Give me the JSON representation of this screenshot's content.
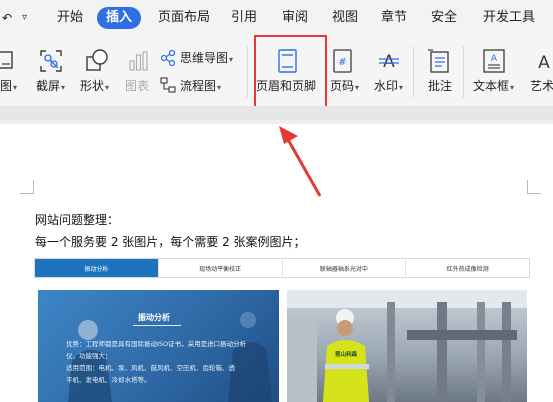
{
  "tabs": [
    "开始",
    "插入",
    "页面布局",
    "引用",
    "审阅",
    "视图",
    "章节",
    "安全",
    "开发工具"
  ],
  "active_tab": "插入",
  "toolbar": {
    "image_label": "图",
    "screenshot_label": "截屏",
    "shape_label": "形状",
    "icon_label": "图表",
    "mindmap_label": "思维导图",
    "flowchart_label": "流程图",
    "header_footer_label": "页眉和页脚",
    "page_number_label": "页码",
    "watermark_label": "水印",
    "comment_label": "批注",
    "textbox_label": "文本框",
    "art_label": "艺术"
  },
  "colors": {
    "accent": "#2f6fe4",
    "highlight": "#e53935",
    "nav_active": "#1e73be"
  },
  "document": {
    "line1": "网站问题整理：",
    "line2": "每一个服务要 2 张图片，每个需要 2 张案例图片；"
  },
  "embedded_page": {
    "nav": [
      "振动分析",
      "现场动平衡校正",
      "联轴器轴系光对中",
      "红外热成像检测"
    ],
    "photo_title": "振动分析",
    "photo_text": [
      "优势：工程师都是具有国际振动ISO证书，采用是进口振动分析",
      "仪，功能强大；",
      "适用范围：电机、泵、风机、鼓风机、空压机、齿轮箱、透",
      "平机、发电机、冷却水塔等。"
    ],
    "vest_text": "昆山利森"
  }
}
